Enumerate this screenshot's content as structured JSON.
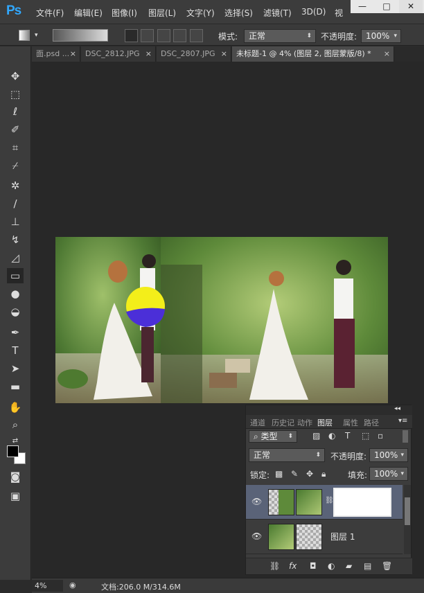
{
  "app": {
    "logo": "Ps"
  },
  "menu": [
    "文件(F)",
    "编辑(E)",
    "图像(I)",
    "图层(L)",
    "文字(Y)",
    "选择(S)",
    "滤镜(T)",
    "3D(D)",
    "视"
  ],
  "window_controls": {
    "minimize": "—",
    "maximize": "□",
    "close": "✕"
  },
  "options": {
    "mode_label": "模式:",
    "mode_value": "正常",
    "opacity_label": "不透明度:",
    "opacity_value": "100%"
  },
  "tabs": [
    {
      "label": "面.psd ...",
      "close": "×"
    },
    {
      "label": "DSC_2812.JPG",
      "close": "×"
    },
    {
      "label": "DSC_2807.JPG",
      "close": "×"
    },
    {
      "label": "未标题-1 @ 4% (图层 2, 图层蒙版/8) *",
      "close": "×"
    }
  ],
  "status": {
    "zoom": "4%",
    "doc_info": "文档:206.0 M/314.6M"
  },
  "layers_panel": {
    "tabs": [
      "通道",
      "历史记",
      "动作",
      "图层",
      "属性",
      "路径"
    ],
    "filter_kind": "类型",
    "blend_mode": "正常",
    "opacity_label": "不透明度:",
    "opacity_value": "100%",
    "lock_label": "锁定:",
    "fill_label": "填充:",
    "fill_value": "100%",
    "layers": [
      {
        "name": "",
        "selected": true
      },
      {
        "name": "图层 1",
        "selected": false
      }
    ]
  }
}
